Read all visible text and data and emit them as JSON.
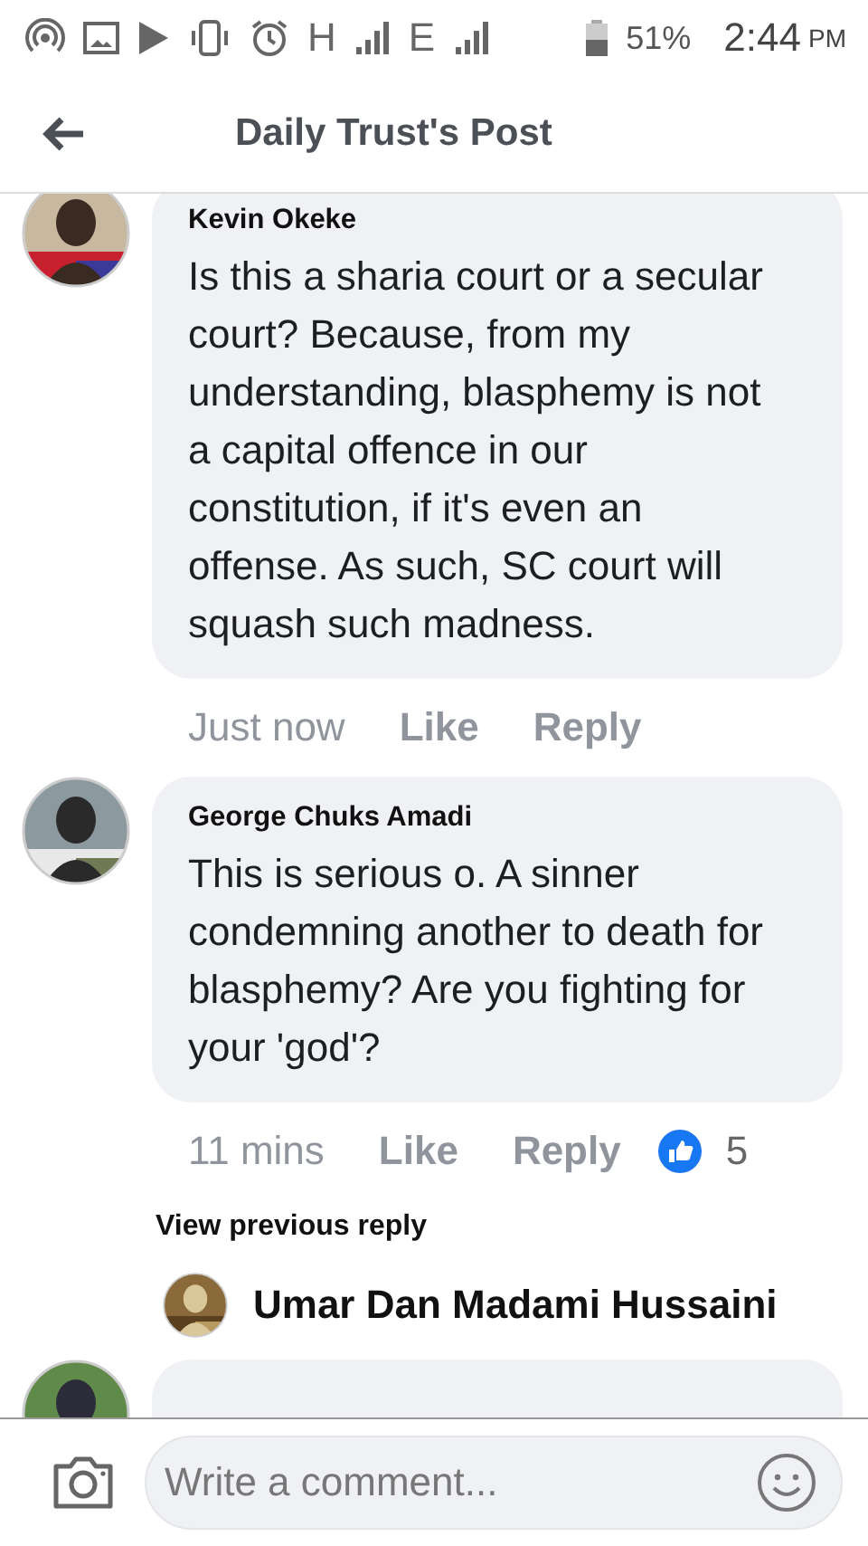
{
  "status_bar": {
    "network_1": "H",
    "network_2": "E",
    "battery": "51%",
    "time": "2:44",
    "time_suffix": "PM"
  },
  "header": {
    "title": "Daily Trust's Post"
  },
  "comments": [
    {
      "author": "Kevin Okeke",
      "text": "Is this a sharia court or a secular court? Because, from my understanding, blasphemy is not a capital offence in our constitution, if it's even an offense. As such, SC court will squash such madness.",
      "time": "Just now",
      "actions": [
        "Like",
        "Reply"
      ]
    },
    {
      "author": "George Chuks Amadi",
      "text": "This is serious o. A sinner condemning another to death for blasphemy? Are you fighting for your 'god'?",
      "time": "11 mins",
      "actions": [
        "Like",
        "Reply"
      ],
      "reactions": "5"
    }
  ],
  "view_previous": "View previous reply",
  "reply_preview": {
    "author": "Umar Dan Madami Hussaini"
  },
  "composer": {
    "placeholder": "Write a comment..."
  }
}
